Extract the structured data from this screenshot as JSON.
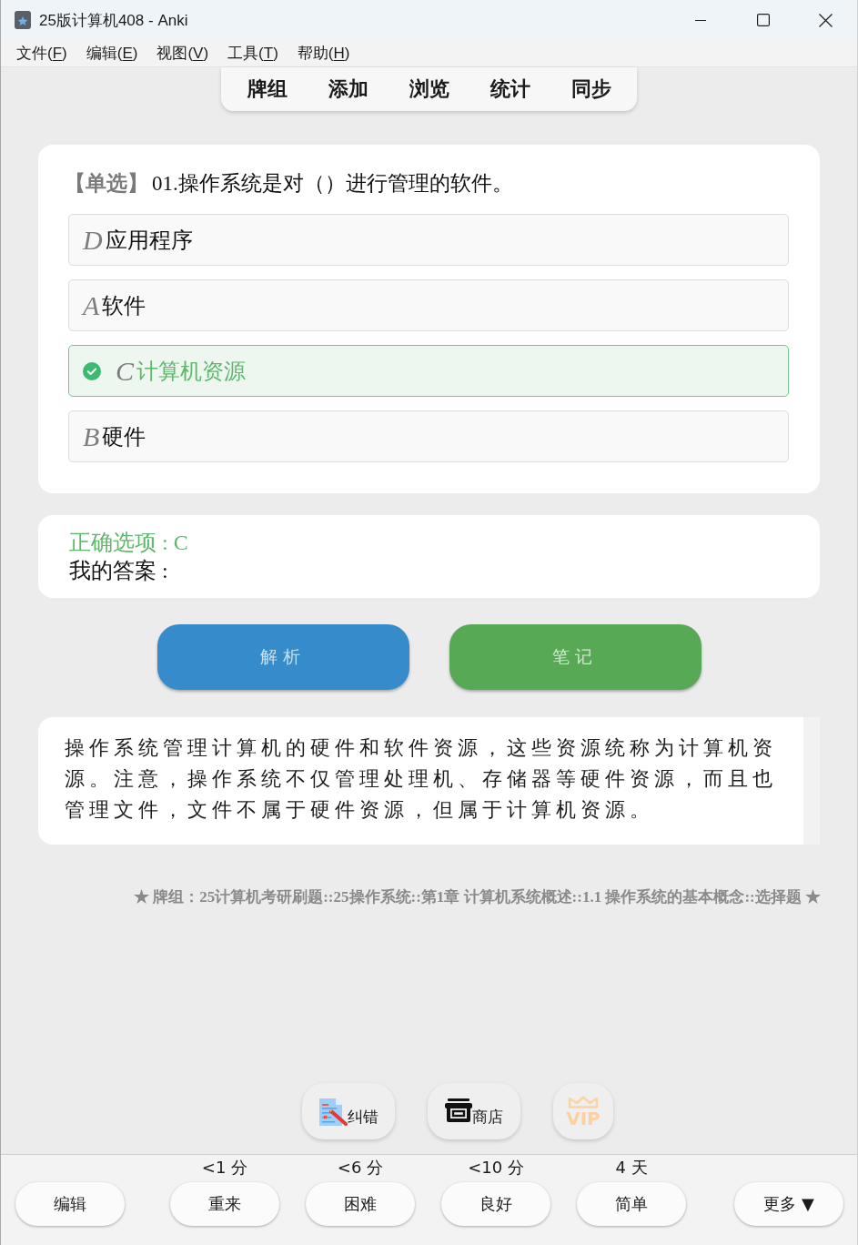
{
  "window": {
    "title": "25版计算机408 - Anki"
  },
  "menu_bar": [
    {
      "before": "文件(",
      "mnemonic": "F",
      "after": ")"
    },
    {
      "before": "编辑(",
      "mnemonic": "E",
      "after": ")"
    },
    {
      "before": "视图(",
      "mnemonic": "V",
      "after": ")"
    },
    {
      "before": "工具(",
      "mnemonic": "T",
      "after": ")"
    },
    {
      "before": "帮助(",
      "mnemonic": "H",
      "after": ")"
    }
  ],
  "toolbar": [
    "牌组",
    "添加",
    "浏览",
    "统计",
    "同步"
  ],
  "question": {
    "tag": "【单选】",
    "text": "01.操作系统是对（）进行管理的软件。",
    "options": [
      {
        "letter": "D",
        "text": "应用程序",
        "correct": false
      },
      {
        "letter": "A",
        "text": "软件",
        "correct": false
      },
      {
        "letter": "C",
        "text": "计算机资源",
        "correct": true
      },
      {
        "letter": "B",
        "text": "硬件",
        "correct": false
      }
    ]
  },
  "answer": {
    "correct_option": "正确选项 : C",
    "my_answer": "我的答案 :"
  },
  "action_buttons": [
    {
      "label": "解析",
      "color": "#368ccb"
    },
    {
      "label": "笔记",
      "color": "#57a955"
    }
  ],
  "explanation": "操作系统管理计算机的硬件和软件资源，这些资源统称为计算机资源。注意，操作系统不仅管理处理机、存储器等硬件资源，而且也管理文件，文件不属于硬件资源，但属于计算机资源。",
  "deck_path": "★ 牌组：25计算机考研刷题::25操作系统::第1章 计算机系统概述::1.1 操作系统的基本概念::选择题 ★",
  "quick_buttons": [
    {
      "kind": "report",
      "label": "纠错"
    },
    {
      "kind": "store",
      "label": "商店"
    },
    {
      "kind": "vip",
      "label": "VIP"
    }
  ],
  "bottom_bar": {
    "edit_button": "编辑",
    "ease_buttons": [
      {
        "interval": "<1 分",
        "label": "重来"
      },
      {
        "interval": "<6 分",
        "label": "困难"
      },
      {
        "interval": "<10 分",
        "label": "良好"
      },
      {
        "interval": "4 天",
        "label": "简单"
      }
    ],
    "more_button": "更多 ▼"
  }
}
